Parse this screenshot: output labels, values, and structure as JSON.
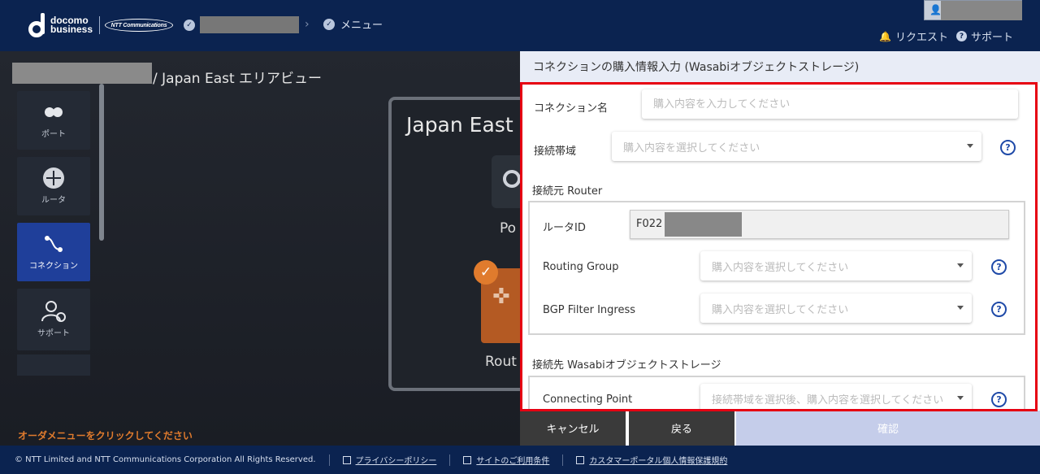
{
  "header": {
    "logo_line1": "docomo",
    "logo_line2": "business",
    "ntt_logo": "NTT Communications",
    "breadcrumb_menu": "メニュー",
    "request_label": "リクエスト",
    "support_label": "サポート"
  },
  "area": {
    "title_suffix": "/ Japan East エリアビュー",
    "map_title": "Japan East",
    "port_label": "Po",
    "router_label": "Rout"
  },
  "sidebar": {
    "items": [
      {
        "label": "ポート",
        "icon": "port-icon"
      },
      {
        "label": "ルータ",
        "icon": "router-icon"
      },
      {
        "label": "コネクション",
        "icon": "connection-icon",
        "active": true
      },
      {
        "label": "サポート",
        "icon": "support-icon"
      }
    ]
  },
  "order_hint": "オーダメニューをクリックしてください",
  "footer": {
    "copyright": "© NTT Limited and NTT Communications Corporation All Rights Reserved.",
    "links": [
      "プライバシーポリシー",
      "サイトのご利用条件",
      "カスタマーポータル個人情報保護規約"
    ]
  },
  "drawer": {
    "title": "コネクションの購入情報入力 (Wasabiオブジェクトストレージ)",
    "connection_name_label": "コネクション名",
    "connection_name_placeholder": "購入内容を入力してください",
    "bandwidth_label": "接続帯域",
    "bandwidth_placeholder": "購入内容を選択してください",
    "source_section": "接続元 Router",
    "router_id_label": "ルータID",
    "router_id_value": "F022",
    "routing_group_label": "Routing Group",
    "routing_group_placeholder": "購入内容を選択してください",
    "bgp_label": "BGP Filter Ingress",
    "bgp_placeholder": "購入内容を選択してください",
    "dest_section": "接続先 Wasabiオブジェクトストレージ",
    "connecting_point_label": "Connecting Point",
    "connecting_point_placeholder": "接続帯域を選択後、購入内容を選択してください",
    "help_glyph": "?",
    "buttons": {
      "cancel": "キャンセル",
      "back": "戻る",
      "confirm": "確認"
    }
  }
}
